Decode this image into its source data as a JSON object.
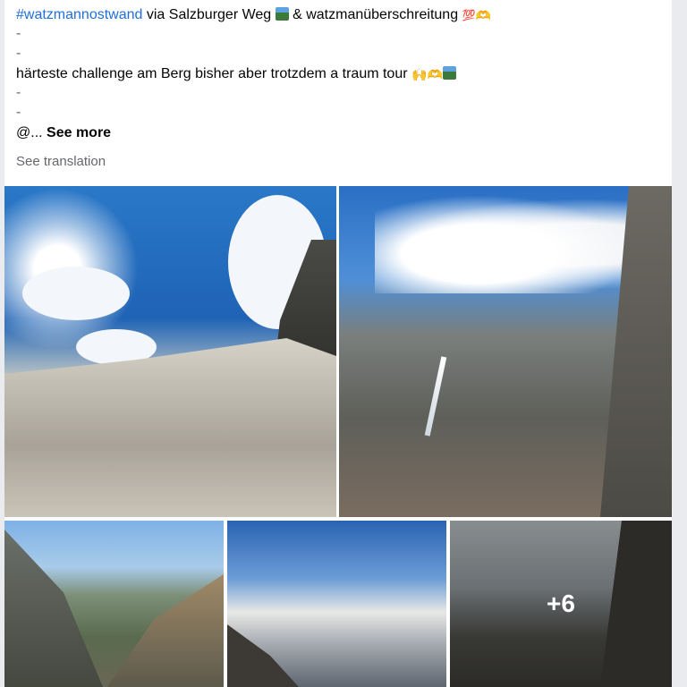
{
  "post": {
    "hashtag": "#watzmannostwand",
    "line1_rest": " via Salzburger Weg",
    "line1_amp": " & watzmanüberschreitung ",
    "dash": "-",
    "line2": "härteste challenge am Berg bisher aber trotzdem a traum tour ",
    "mention": "@... ",
    "see_more": "See more",
    "see_translation": "See translation"
  },
  "emoji": {
    "mountain": "mountain-photo-emoji",
    "hundred": "💯",
    "hands_raised": "🙌",
    "heart_hands": "🫶"
  },
  "photos": {
    "more_count": "+6"
  },
  "colors": {
    "hashtag": "#216fdb",
    "text": "#050505",
    "muted": "#65676b"
  }
}
